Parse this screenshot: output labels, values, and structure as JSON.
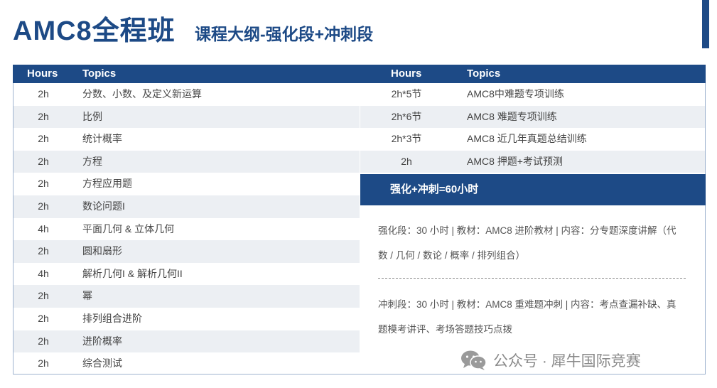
{
  "title": {
    "main": "AMC8全程班",
    "sub": "课程大纲-强化段+冲刺段"
  },
  "table": {
    "left_headers": {
      "hours": "Hours",
      "topics": "Topics"
    },
    "right_headers": {
      "hours": "Hours",
      "topics": "Topics"
    },
    "left_rows": [
      {
        "hours": "2h",
        "topic": "分数、小数、及定义新运算"
      },
      {
        "hours": "2h",
        "topic": "比例"
      },
      {
        "hours": "2h",
        "topic": "统计概率"
      },
      {
        "hours": "2h",
        "topic": "方程"
      },
      {
        "hours": "2h",
        "topic": "方程应用题"
      },
      {
        "hours": "2h",
        "topic": "数论问题I"
      },
      {
        "hours": "4h",
        "topic": "平面几何 & 立体几何"
      },
      {
        "hours": "2h",
        "topic": "圆和扇形"
      },
      {
        "hours": "4h",
        "topic": "解析几何I & 解析几何II"
      },
      {
        "hours": "2h",
        "topic": "幂"
      },
      {
        "hours": "2h",
        "topic": "排列组合进阶"
      },
      {
        "hours": "2h",
        "topic": "进阶概率"
      },
      {
        "hours": "2h",
        "topic": "综合测试"
      }
    ],
    "right_rows": [
      {
        "hours": "2h*5节",
        "topic": "AMC8中难题专项训练"
      },
      {
        "hours": "2h*6节",
        "topic": "AMC8 难题专项训练"
      },
      {
        "hours": "2h*3节",
        "topic": "AMC8 近几年真题总结训练"
      },
      {
        "hours": "2h",
        "topic": "AMC8 押题+考试预测"
      }
    ]
  },
  "summary": {
    "total": "强化+冲刺=60小时",
    "intensive_line1": "强化段：30 小时 | 教材：AMC8 进阶教材 | 内容：分专题深度讲解（代",
    "intensive_line2": "数 / 几何 / 数论 / 概率 / 排列组合）",
    "sprint_line1": "冲刺段：30 小时 | 教材：AMC8 重难题冲刺 | 内容：考点查漏补缺、真",
    "sprint_line2": "题模考讲评、考场答题技巧点拨"
  },
  "watermark": {
    "text": "公众号 · 犀牛国际竞赛",
    "icon": "wechat-icon"
  },
  "colors": {
    "brand": "#1d4a86",
    "row_alt": "#eceff3",
    "watermark": "#8a8a8a"
  }
}
